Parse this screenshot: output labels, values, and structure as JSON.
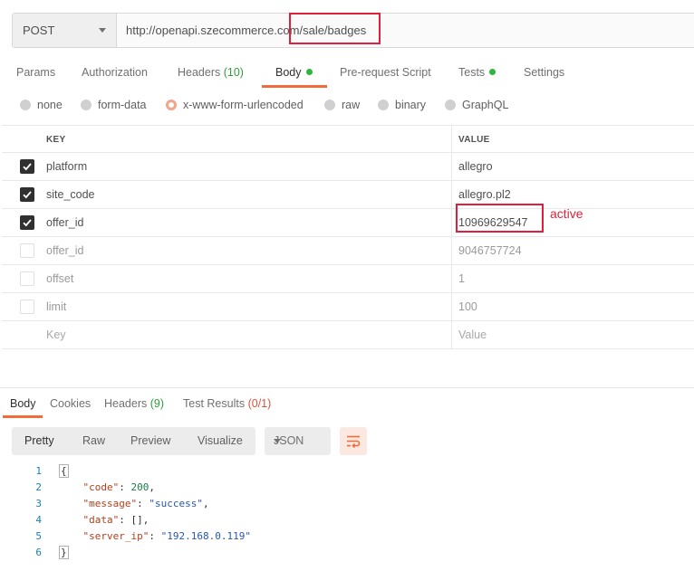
{
  "request": {
    "method": "POST",
    "url": "http://openapi.szecommerce.com/sale/badges"
  },
  "tabs": [
    {
      "label": "Params"
    },
    {
      "label": "Authorization"
    },
    {
      "label": "Headers",
      "count": "(10)"
    },
    {
      "label": "Body"
    },
    {
      "label": "Pre-request Script"
    },
    {
      "label": "Tests"
    },
    {
      "label": "Settings"
    }
  ],
  "body_types": [
    "none",
    "form-data",
    "x-www-form-urlencoded",
    "raw",
    "binary",
    "GraphQL"
  ],
  "selected_body_type": "x-www-form-urlencoded",
  "table": {
    "key_header": "KEY",
    "value_header": "VALUE",
    "rows": [
      {
        "key": "platform",
        "value": "allegro",
        "checked": true
      },
      {
        "key": "site_code",
        "value": "allegro.pl2",
        "checked": true
      },
      {
        "key": "offer_id",
        "value": "10969629547",
        "checked": true
      },
      {
        "key": "offer_id",
        "value": "9046757724",
        "checked": false
      },
      {
        "key": "offset",
        "value": "1",
        "checked": false
      },
      {
        "key": "limit",
        "value": "100",
        "checked": false
      }
    ],
    "placeholder_key": "Key",
    "placeholder_value": "Value"
  },
  "annotation": "active",
  "response": {
    "tabs": [
      {
        "label": "Body"
      },
      {
        "label": "Cookies"
      },
      {
        "label": "Headers",
        "count": "(9)"
      },
      {
        "label": "Test Results",
        "count": "(0/1)"
      }
    ],
    "views": [
      "Pretty",
      "Raw",
      "Preview",
      "Visualize"
    ],
    "format": "JSON",
    "lines": [
      "1",
      "2",
      "3",
      "4",
      "5",
      "6"
    ],
    "json": {
      "open": "{",
      "code_key": "\"code\"",
      "code_val": "200",
      "message_key": "\"message\"",
      "message_val": "\"success\"",
      "data_key": "\"data\"",
      "data_val": "[]",
      "server_key": "\"server_ip\"",
      "server_val": "\"192.168.0.119\"",
      "close": "}"
    }
  },
  "colors": {
    "accent": "#f26b3a",
    "highlight_box": "#e0203a",
    "count_green": "#2e9e3b"
  }
}
